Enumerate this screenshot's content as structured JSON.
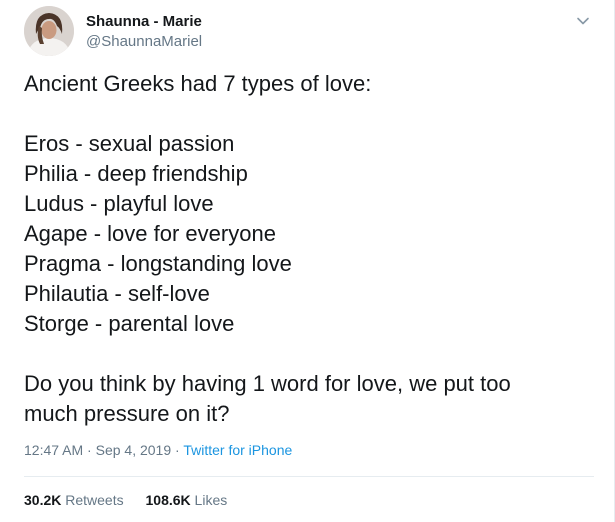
{
  "author": {
    "name": "Shaunna - Marie",
    "handle": "@ShaunnaMariel"
  },
  "tweet": {
    "intro": "Ancient Greeks had 7 types of love:",
    "types": [
      "Eros - sexual passion",
      "Philia - deep friendship",
      "Ludus - playful love",
      "Agape - love for everyone",
      "Pragma - longstanding love",
      "Philautia - self-love",
      "Storge - parental love"
    ],
    "question_line1": "Do you think by having 1 word for love, we put too",
    "question_line2": "much pressure on it?"
  },
  "meta": {
    "time": "12:47 AM",
    "separator": "·",
    "date": "Sep 4, 2019",
    "source": "Twitter for iPhone"
  },
  "stats": {
    "retweets_count": "30.2K",
    "retweets_label": "Retweets",
    "likes_count": "108.6K",
    "likes_label": "Likes"
  },
  "colors": {
    "text": "#14171a",
    "secondary": "#657786",
    "link": "#1b95e0",
    "divider": "#e6ecf0"
  },
  "icons": {
    "more": "chevron-down-icon"
  }
}
